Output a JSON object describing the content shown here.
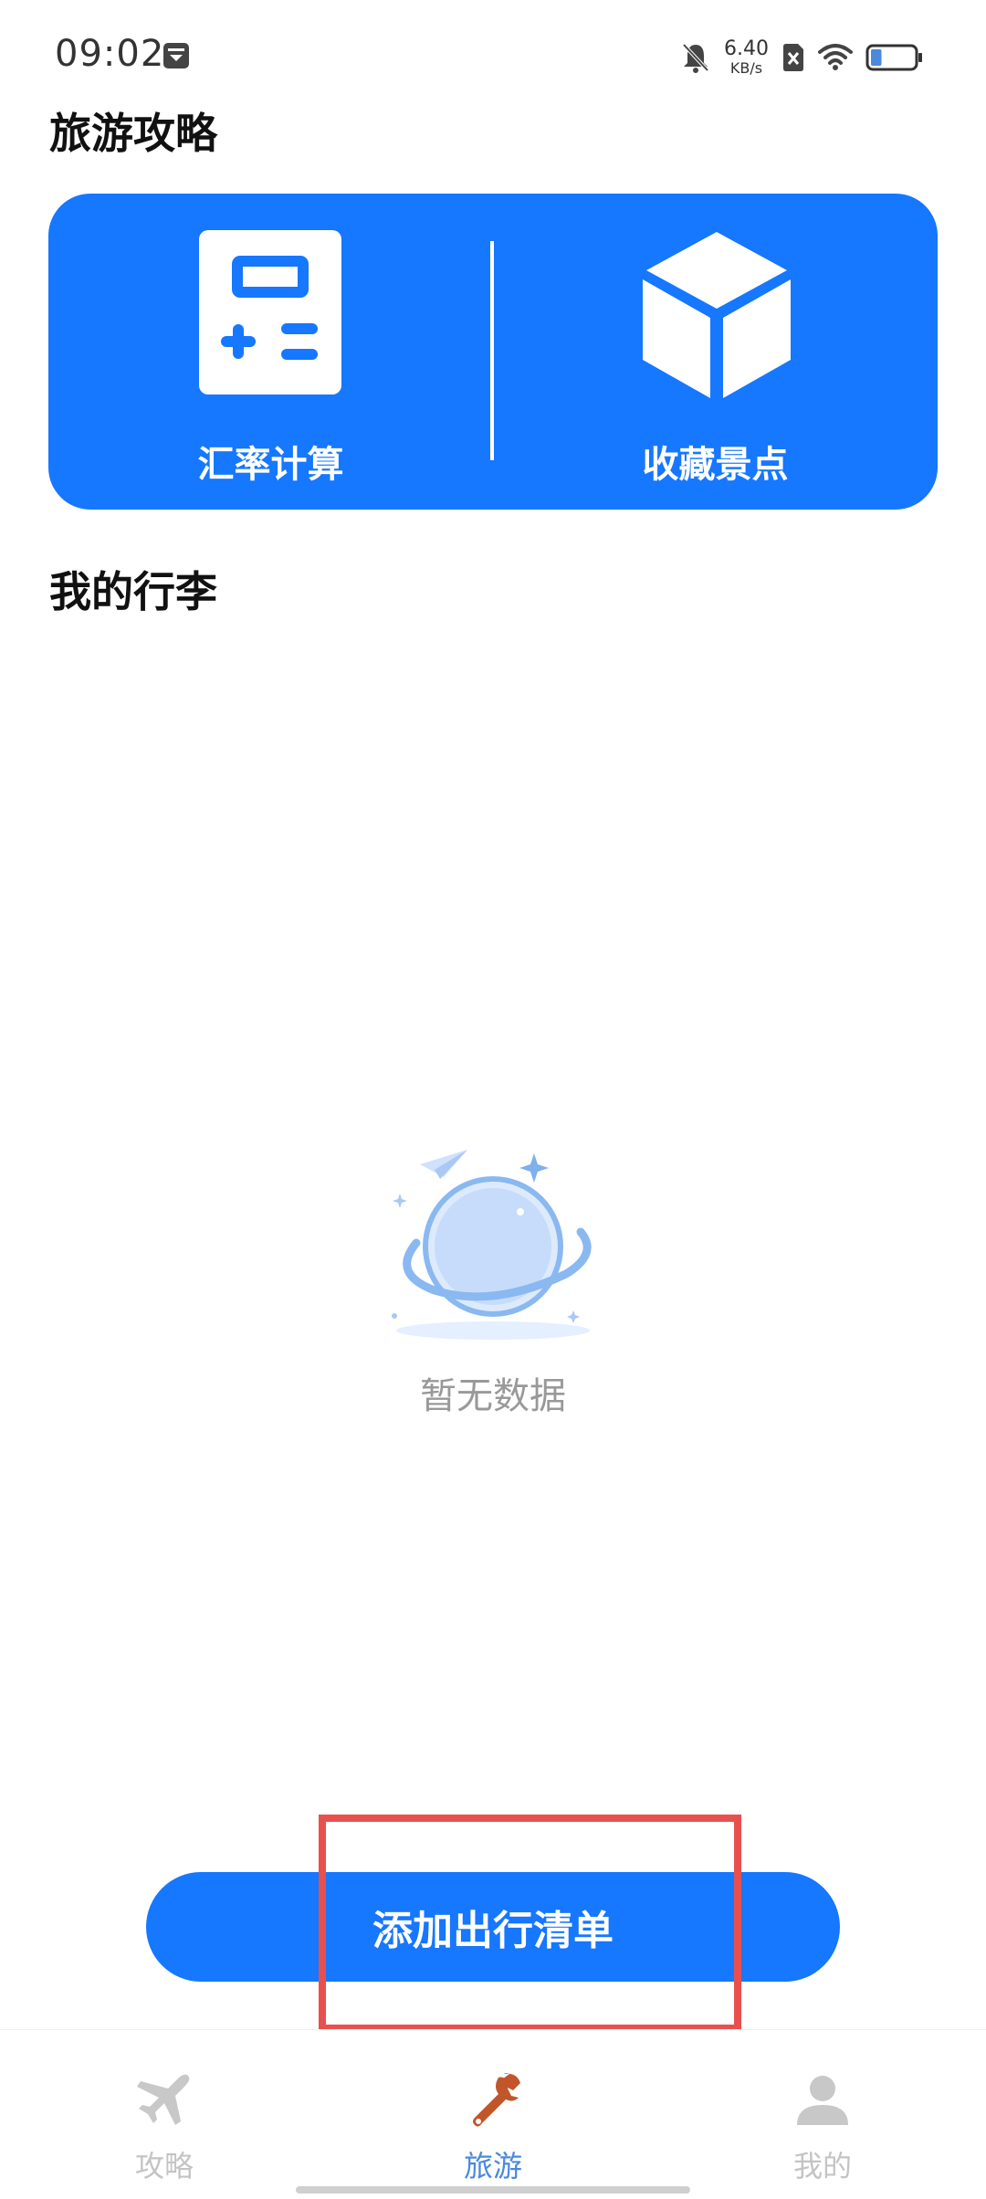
{
  "status_bar": {
    "time": "09:02",
    "net_speed_value": "6.40",
    "net_speed_unit": "KB/s",
    "battery_level_percent": 25
  },
  "sections": {
    "guide_title": "旅游攻略",
    "luggage_title": "我的行李"
  },
  "tools": [
    {
      "label": "汇率计算",
      "icon": "calculator-icon"
    },
    {
      "label": "收藏景点",
      "icon": "cube-icon"
    }
  ],
  "empty_state": {
    "text": "暂无数据",
    "icon": "empty-planet-icon"
  },
  "add_button": {
    "label": "添加出行清单"
  },
  "bottom_nav": {
    "items": [
      {
        "label": "攻略",
        "icon": "airplane-icon",
        "active": false
      },
      {
        "label": "旅游",
        "icon": "wrench-icon",
        "active": true
      },
      {
        "label": "我的",
        "icon": "user-icon",
        "active": false
      }
    ]
  },
  "colors": {
    "primary": "#1677ff",
    "highlight": "#e8504e",
    "active_tab": "#4a89dc",
    "inactive_tab": "#c4c4c4",
    "wrench": "#c0562a"
  }
}
